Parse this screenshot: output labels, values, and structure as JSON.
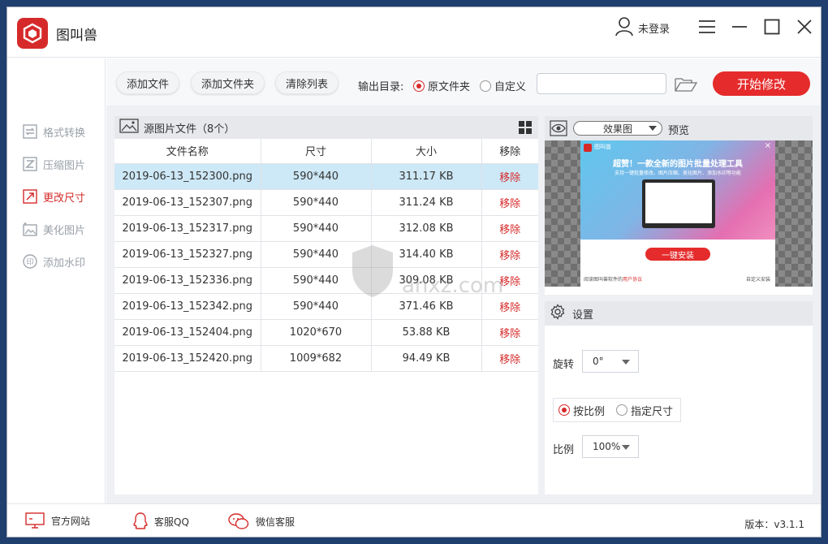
{
  "app": {
    "name": "图叫兽"
  },
  "header": {
    "user_label": "未登录"
  },
  "sidebar": {
    "items": [
      {
        "label": "格式转换",
        "active": false,
        "icon": "format-icon"
      },
      {
        "label": "压缩图片",
        "active": false,
        "icon": "compress-icon"
      },
      {
        "label": "更改尺寸",
        "active": true,
        "icon": "resize-icon"
      },
      {
        "label": "美化图片",
        "active": false,
        "icon": "beautify-icon"
      },
      {
        "label": "添加水印",
        "active": false,
        "icon": "watermark-icon"
      }
    ]
  },
  "toolbar": {
    "add_file": "添加文件",
    "add_folder": "添加文件夹",
    "clear_list": "清除列表",
    "output_label": "输出目录:",
    "opt_original": "原文件夹",
    "opt_custom": "自定义",
    "path_value": "",
    "start": "开始修改"
  },
  "files": {
    "title": "源图片文件（8个）",
    "columns": [
      "文件名称",
      "尺寸",
      "大小",
      "移除"
    ],
    "rows": [
      {
        "name": "2019-06-13_152300.png",
        "size": "590*440",
        "bytes": "311.17 KB",
        "remove": "移除"
      },
      {
        "name": "2019-06-13_152307.png",
        "size": "590*440",
        "bytes": "311.24 KB",
        "remove": "移除"
      },
      {
        "name": "2019-06-13_152317.png",
        "size": "590*440",
        "bytes": "312.08 KB",
        "remove": "移除"
      },
      {
        "name": "2019-06-13_152327.png",
        "size": "590*440",
        "bytes": "314.40 KB",
        "remove": "移除"
      },
      {
        "name": "2019-06-13_152336.png",
        "size": "590*440",
        "bytes": "309.08 KB",
        "remove": "移除"
      },
      {
        "name": "2019-06-13_152342.png",
        "size": "590*440",
        "bytes": "371.46 KB",
        "remove": "移除"
      },
      {
        "name": "2019-06-13_152404.png",
        "size": "1020*670",
        "bytes": "53.88 KB",
        "remove": "移除"
      },
      {
        "name": "2019-06-13_152420.png",
        "size": "1009*682",
        "bytes": "94.49 KB",
        "remove": "移除"
      }
    ]
  },
  "preview": {
    "mode": "效果图",
    "label": "预览",
    "thumb": {
      "app_name": "图叫兽",
      "headline": "超赞！一款全新的图片批量处理工具",
      "sub": "支持一键批量修改、图片压缩、美化图片、添加水印等功能",
      "install": "一键安装",
      "agree": "阅读图叫兽软件的",
      "agree_link": "用户协议",
      "custom": "自定义安装"
    }
  },
  "settings": {
    "title": "设置",
    "rotate_label": "旋转",
    "rotate_value": "0°",
    "opt_ratio": "按比例",
    "opt_size": "指定尺寸",
    "ratio_label": "比例",
    "ratio_value": "100%"
  },
  "footer": {
    "website": "官方网站",
    "qq": "客服QQ",
    "wechat": "微信客服",
    "version": "版本：v3.1.1"
  },
  "watermark": {
    "text": "anxz.com"
  },
  "colors": {
    "accent": "#e52b2b",
    "selected_row": "#cde8f6",
    "panel_head": "#e6e8ec"
  }
}
